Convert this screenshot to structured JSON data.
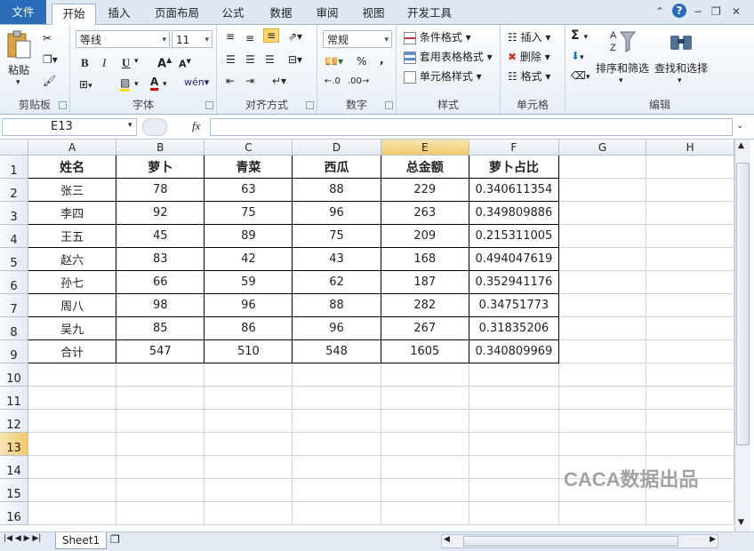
{
  "tabs": [
    "文件",
    "开始",
    "插入",
    "页面布局",
    "公式",
    "数据",
    "审阅",
    "视图",
    "开发工具"
  ],
  "ribbon": {
    "clipboard": {
      "paste": "粘贴",
      "label": "剪贴板"
    },
    "font": {
      "name": "等线",
      "size": "11",
      "bold": "B",
      "italic": "I",
      "underline": "U",
      "label": "字体"
    },
    "alignment": {
      "label": "对齐方式"
    },
    "number": {
      "format": "常规",
      "percent": "%",
      "comma": ",",
      "label": "数字"
    },
    "styles": {
      "conditional": "条件格式",
      "table": "套用表格格式",
      "cell": "单元格样式",
      "label": "样式"
    },
    "cells": {
      "insert": "插入",
      "delete": "删除",
      "format": "格式",
      "label": "单元格"
    },
    "editing": {
      "sort": "排序和筛选",
      "find": "查找和选择",
      "label": "编辑"
    }
  },
  "formula_bar": {
    "name_box": "E13",
    "fx": "fx",
    "value": ""
  },
  "columns": [
    "A",
    "B",
    "C",
    "D",
    "E",
    "F",
    "G",
    "H"
  ],
  "row_numbers": [
    "1",
    "2",
    "3",
    "4",
    "5",
    "6",
    "7",
    "8",
    "9",
    "10",
    "11",
    "12",
    "13",
    "14",
    "15",
    "16"
  ],
  "table": {
    "header": [
      "姓名",
      "萝卜",
      "青菜",
      "西瓜",
      "总金额",
      "萝卜占比"
    ],
    "rows": [
      [
        "张三",
        "78",
        "63",
        "88",
        "229",
        "0.340611354"
      ],
      [
        "李四",
        "92",
        "75",
        "96",
        "263",
        "0.349809886"
      ],
      [
        "王五",
        "45",
        "89",
        "75",
        "209",
        "0.215311005"
      ],
      [
        "赵六",
        "83",
        "42",
        "43",
        "168",
        "0.494047619"
      ],
      [
        "孙七",
        "66",
        "59",
        "62",
        "187",
        "0.352941176"
      ],
      [
        "周八",
        "98",
        "96",
        "88",
        "282",
        "0.34751773"
      ],
      [
        "吴九",
        "85",
        "86",
        "96",
        "267",
        "0.31835206"
      ],
      [
        "合计",
        "547",
        "510",
        "548",
        "1605",
        "0.340809969"
      ]
    ]
  },
  "sheet_tab": "Sheet1",
  "watermark": "CACA数据出品"
}
